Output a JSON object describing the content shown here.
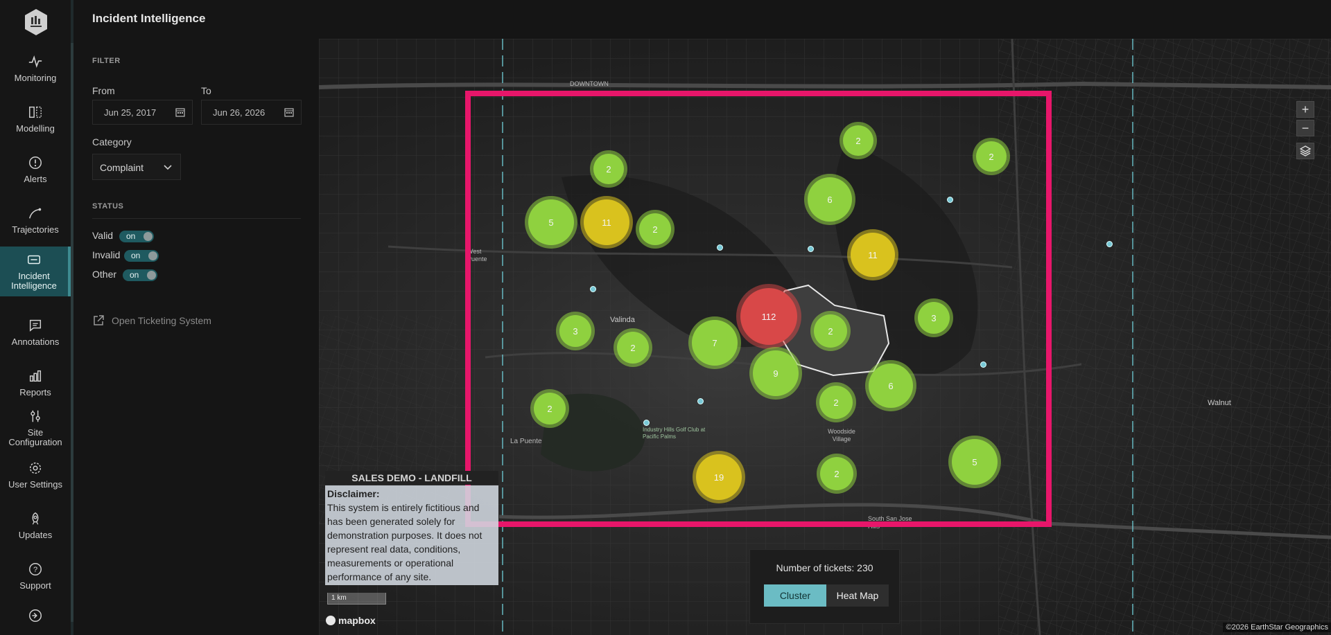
{
  "header": {
    "title": "Incident Intelligence"
  },
  "nav": {
    "items": [
      {
        "label": "Monitoring",
        "icon": "pulse-icon"
      },
      {
        "label": "Modelling",
        "icon": "model-icon"
      },
      {
        "label": "Alerts",
        "icon": "alert-icon"
      },
      {
        "label": "Trajectories",
        "icon": "trajectory-icon"
      },
      {
        "label": "Incident Intelligence",
        "icon": "ticket-icon",
        "active": true
      },
      {
        "label": "Annotations",
        "icon": "annotation-icon"
      },
      {
        "label": "Reports",
        "icon": "chart-icon"
      },
      {
        "label": "Site Configuration",
        "icon": "sliders-icon"
      },
      {
        "label": "User Settings",
        "icon": "gear-icon"
      },
      {
        "label": "Updates",
        "icon": "rocket-icon"
      },
      {
        "label": "Support",
        "icon": "help-icon"
      },
      {
        "label": "",
        "icon": "logout-icon"
      }
    ]
  },
  "filter": {
    "section": "FILTER",
    "from_label": "From",
    "to_label": "To",
    "from_value": "Jun 25, 2017",
    "to_value": "Jun 26, 2026",
    "category_label": "Category",
    "category_value": "Complaint",
    "status_section": "STATUS",
    "statuses": [
      {
        "label": "Valid",
        "state": "on"
      },
      {
        "label": "Invalid",
        "state": "on"
      },
      {
        "label": "Other",
        "state": "on"
      }
    ],
    "ticket_link": "Open Ticketing System"
  },
  "map": {
    "clusters": [
      {
        "count": "2",
        "color": "green"
      },
      {
        "count": "2",
        "color": "green"
      },
      {
        "count": "2",
        "color": "green"
      },
      {
        "count": "6",
        "color": "green"
      },
      {
        "count": "5",
        "color": "green"
      },
      {
        "count": "11",
        "color": "yellow"
      },
      {
        "count": "2",
        "color": "green"
      },
      {
        "count": "11",
        "color": "yellow"
      },
      {
        "count": "112",
        "color": "red"
      },
      {
        "count": "3",
        "color": "green"
      },
      {
        "count": "2",
        "color": "green"
      },
      {
        "count": "3",
        "color": "green"
      },
      {
        "count": "2",
        "color": "green"
      },
      {
        "count": "7",
        "color": "green"
      },
      {
        "count": "9",
        "color": "green"
      },
      {
        "count": "6",
        "color": "green"
      },
      {
        "count": "2",
        "color": "green"
      },
      {
        "count": "2",
        "color": "green"
      },
      {
        "count": "19",
        "color": "yellow"
      },
      {
        "count": "2",
        "color": "green"
      },
      {
        "count": "5",
        "color": "green"
      }
    ],
    "place_labels": [
      "DOWNTOWN",
      "Valinda",
      "West Puente",
      "Woodside Village",
      "Walnut",
      "La Puente",
      "South San Jose Hills",
      "Industry Hills Golf Club at Pacific Palms"
    ],
    "zoom_in": "+",
    "zoom_out": "−",
    "disclaimer_title": "SALES DEMO - LANDFILL",
    "disclaimer_heading": "Disclaimer:",
    "disclaimer_text": "This system is entirely fictitious and has been generated solely for demonstration purposes. It does not represent real data, conditions, measurements or operational performance of any site.",
    "scale": "1 km",
    "logo": "mapbox",
    "attribution": "©2026 EarthStar Geographics",
    "tickets_text": "Number of tickets: 230",
    "mode_cluster": "Cluster",
    "mode_heatmap": "Heat Map"
  },
  "colors": {
    "accent": "#1c4e54",
    "frame": "#e7166a",
    "green": "#8fd13f",
    "yellow": "#d9c21e",
    "red": "#d84848"
  }
}
